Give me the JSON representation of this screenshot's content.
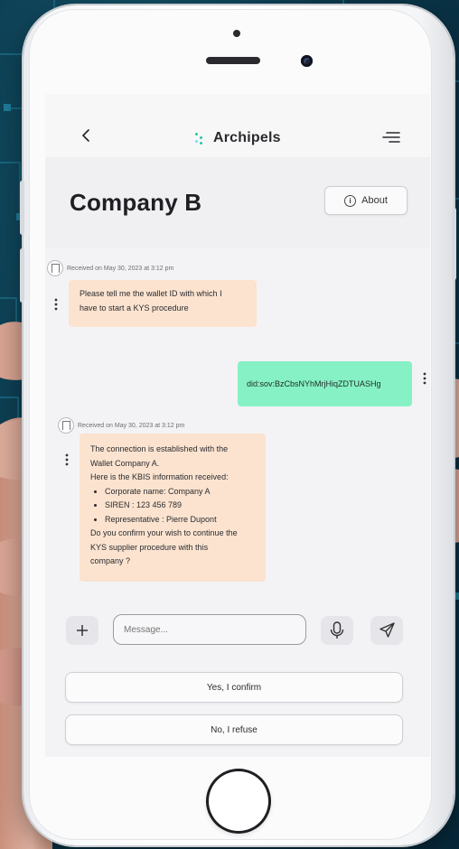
{
  "app": {
    "brand_name": "Archipels",
    "accent_color": "#29c7a8"
  },
  "header": {
    "title": "Company B",
    "about_label": "About"
  },
  "messages": [
    {
      "direction": "in",
      "meta": "Received on May 30, 2023 at 3:12 pm",
      "lines": [
        "Please tell me the wallet ID with which I",
        "have to start a KYS procedure"
      ]
    },
    {
      "direction": "out",
      "text": "did:sov:BzCbsNYhMrjHiqZDTUASHg"
    },
    {
      "direction": "in",
      "meta": "Received on May 30, 2023 at 3:12 pm",
      "lines": [
        "The connection is established with the",
        "Wallet Company A.",
        "Here is the KBIS information received:"
      ],
      "bullets": [
        "Corporate name: Company A",
        "SIREN : 123 456 789",
        "Representative : Pierre Dupont"
      ],
      "closing": [
        "Do you confirm your wish to continue the",
        "KYS supplier procedure with this",
        "company ?"
      ]
    }
  ],
  "composer": {
    "placeholder": "Message..."
  },
  "choices": {
    "confirm": "Yes, I confirm",
    "refuse": "No, I refuse"
  },
  "colors": {
    "incoming_bubble": "#fbe3cf",
    "outgoing_bubble": "#86f1c5"
  }
}
